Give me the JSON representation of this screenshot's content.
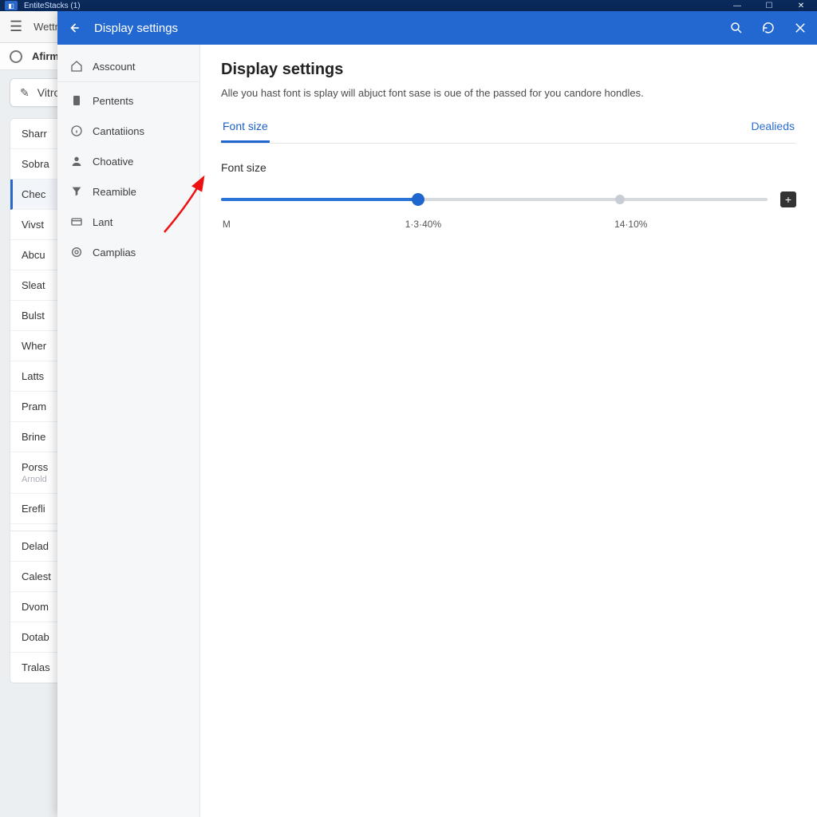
{
  "titlebar": {
    "app_name": "EntiteStacks (1)"
  },
  "background": {
    "toolbar_label": "Wettr",
    "tab_label": "Afirm",
    "compose_label": "Vitrot",
    "list_group1": [
      "Sharr",
      "Sobra",
      "Chec",
      "Vivst",
      "Abcu",
      "Sleat",
      "Bulst",
      "Wher",
      "Latts",
      "Pram",
      "Brine"
    ],
    "list_anchor": {
      "title": "Porss",
      "sub": "Arnold"
    },
    "list_anchor2": "Erefli",
    "list_group2": [
      "Delad",
      "Calest",
      "Dvom",
      "Dotab",
      "Tralas"
    ]
  },
  "overlay": {
    "header_title": "Display settings"
  },
  "settings_nav": [
    {
      "icon": "home",
      "label": "Asscount"
    },
    {
      "icon": "file",
      "label": "Pentents"
    },
    {
      "icon": "info",
      "label": "Cantatiions"
    },
    {
      "icon": "person",
      "label": "Choative"
    },
    {
      "icon": "funnel",
      "label": "Reamible"
    },
    {
      "icon": "card",
      "label": "Lant"
    },
    {
      "icon": "target",
      "label": "Camplias"
    }
  ],
  "content": {
    "heading": "Display settings",
    "description": "Alle you hast font is splay will abjuct font sase is oue of the passed for you candore hondles.",
    "tab_primary": "Font size",
    "tab_secondary": "Dealieds",
    "section_label": "Font size",
    "marks": {
      "left": "M",
      "mid": "1·3·40%",
      "right": "14·10%"
    }
  }
}
